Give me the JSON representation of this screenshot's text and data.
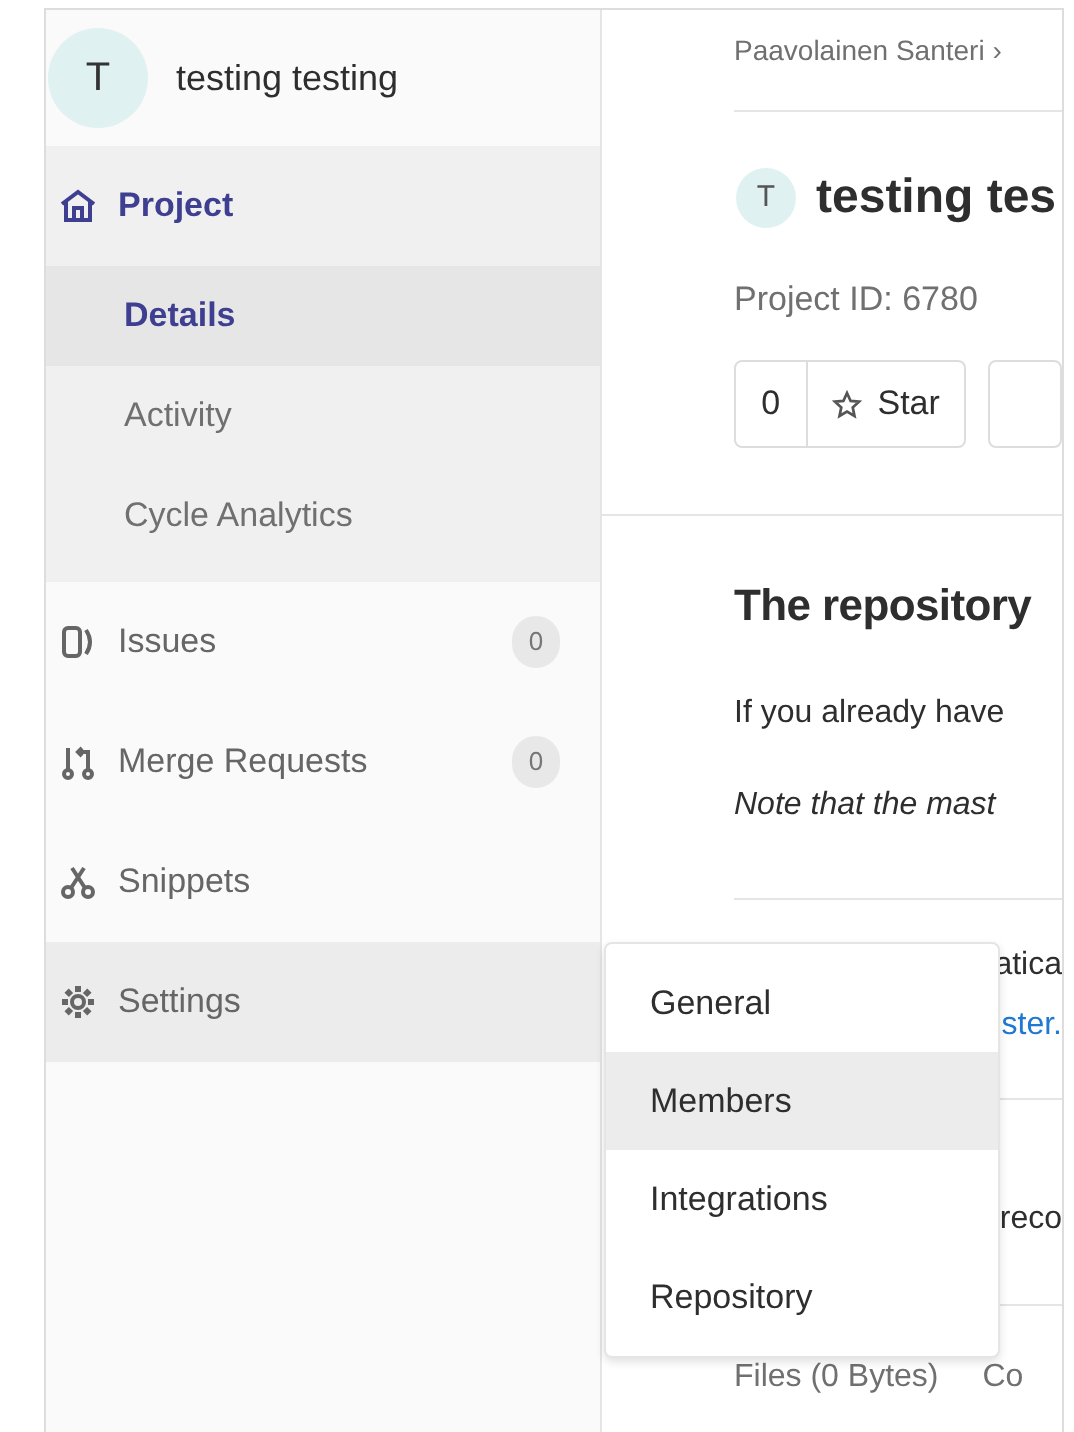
{
  "project": {
    "avatar_letter": "T",
    "name": "testing testing"
  },
  "sidebar": {
    "items": [
      {
        "label": "Project",
        "selected": true,
        "highlighted": false,
        "expanded": true,
        "children": [
          {
            "label": "Details",
            "selected": true
          },
          {
            "label": "Activity",
            "selected": false
          },
          {
            "label": "Cycle Analytics",
            "selected": false
          }
        ]
      },
      {
        "label": "Issues",
        "count": "0",
        "selected": false,
        "highlighted": false
      },
      {
        "label": "Merge Requests",
        "count": "0",
        "selected": false,
        "highlighted": false
      },
      {
        "label": "Snippets",
        "selected": false,
        "highlighted": false
      },
      {
        "label": "Settings",
        "selected": false,
        "highlighted": true
      }
    ]
  },
  "flyout": {
    "items": [
      {
        "label": "General",
        "highlighted": false
      },
      {
        "label": "Members",
        "highlighted": true
      },
      {
        "label": "Integrations",
        "highlighted": false
      },
      {
        "label": "Repository",
        "highlighted": false
      }
    ]
  },
  "main": {
    "breadcrumb": "Paavolainen Santeri",
    "breadcrumb_separator": "›",
    "avatar_letter": "T",
    "title": "testing tes",
    "project_id": "Project ID: 6780",
    "star_count": "0",
    "star_label": "Star",
    "heading": "The repository",
    "paragraph": "If you already have",
    "note": "Note that the mast",
    "covered_texts": [
      {
        "kind": "text",
        "text": "atica"
      },
      {
        "kind": "link",
        "text": "ster."
      },
      {
        "kind": "text",
        "text": "reco"
      }
    ],
    "footer": [
      "Files (0 Bytes)",
      "Co"
    ]
  }
}
